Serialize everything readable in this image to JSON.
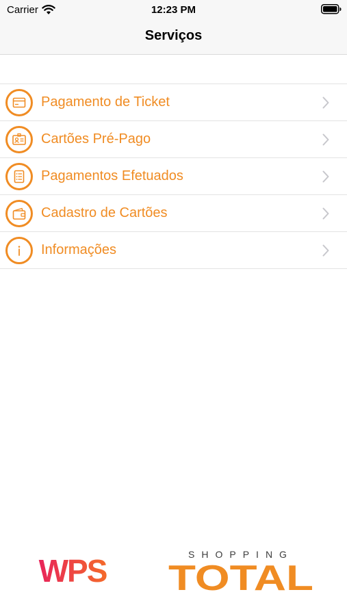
{
  "status_bar": {
    "carrier": "Carrier",
    "time": "12:23 PM",
    "icons": [
      "wifi-icon",
      "battery-icon"
    ]
  },
  "nav": {
    "title": "Serviços"
  },
  "menu": {
    "items": [
      {
        "label": "Pagamento de Ticket",
        "icon": "ticket-icon"
      },
      {
        "label": "Cartões Pré-Pago",
        "icon": "id-card-icon"
      },
      {
        "label": "Pagamentos Efetuados",
        "icon": "receipt-list-icon"
      },
      {
        "label": "Cadastro de Cartões",
        "icon": "wallet-icon"
      },
      {
        "label": "Informações",
        "icon": "info-icon"
      }
    ]
  },
  "footer": {
    "wps_logo": "WPS",
    "shopping_label": "SHOPPING",
    "total_label": "TOTAL"
  },
  "colors": {
    "accent": "#f08c23",
    "wps_gradient": [
      "#e8245a",
      "#f46a2a"
    ],
    "chevron": "#c7c7cc"
  }
}
